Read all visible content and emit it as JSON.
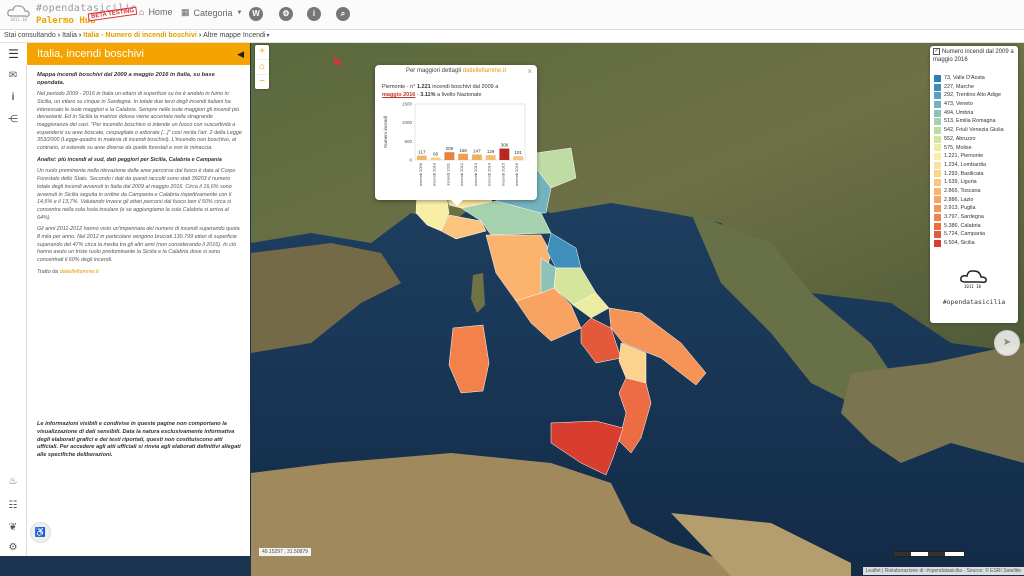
{
  "topbar": {
    "logo_line1": "#opendatasicilia",
    "logo_line2": "Palermo Hub",
    "beta_badge": "BETA TESTING",
    "home_label": "Home",
    "categoria_label": "Categoria"
  },
  "breadcrumb": {
    "prefix": "Stai consultando",
    "level1": "Italia",
    "current": "Italia - Numero di incendi boschivi",
    "next": "Altre mappe Incendi"
  },
  "panel": {
    "title": "Italia, incendi boschivi",
    "intro": "Mappa incendi boschivi dal 2009 a maggio 2016 in Italia, su base opendata.",
    "para1": "Nel periodo 2009 - 2016 in Italia un ettaro di superficie su tre è andato in fumo in Sicilia, un ettaro su cinque in Sardegna. In totale due terzi degli incendi italiani ha interessato le isole maggiori e la Calabria. Sempre nelle isole maggiori gli incendi più devastanti. Ed in Sicilia la matrice dolosa viene accertata nella stragrande maggioranza dei casi. \"Per incendio boschivo si intende un fuoco con suscettività a espandersi su aree boscate, cespugliate o arborate [...]\" così recita l'art. 2 della Legge 353/2000 (Legge-quadro in materia di incendi boschivi). L'incendio non boschivo, al contrario, si estende su aree diverse da quelle forestali e non le minaccia.",
    "analisi": "Analisi: più incendi al sud, dati peggiori per Sicilia, Calabria e Campania",
    "para2": "Un ruolo preminente nella rilevazione delle aree percorse dal fuoco è data al Corpo Forestale dello Stato. Secondo i dati da questi raccolti sono stati 39203 il numero totale degli incendi avvenuti in Italia dal 2009 al maggio 2016. Circa il 16,6% sono avvenuti in Sicilia seguita in ordine da Campania e Calabria rispettivamente con il 14,6% e il 13,7%. Valutando invece gli ettari percorsi dal fuoco ben il 50% circa si concentra nella sola Isola insulare (e se aggiungiamo la sola Calabria si arriva al 64%)",
    "para3": "Gli anni 2011-2012 hanno visto un'impennata del numero di incendi superando quota 8 mila per anno. Nel 2012 in particolare vengono bruciati 130.799 ettari di superficie superando del 47% circa la media tra gli altri anni (non considerando il 2016). In ciò hanno avuto un triste ruolo predominante la Sicilia e la Calabria dove si sono concentrati il 60% degli incendi.",
    "tratto": "Tratto da",
    "tratto_link": "datiellefiamme.it",
    "footer": "Le informazioni visibili e condivise in queste pagine non comportano la visualizzazione di dati sensibili. Data la natura esclusivamente informativa degli elaborati grafici e dei testi riportati, questi non costituiscono atti ufficiali. Per accedere agli atti ufficiali si rinvia agli elaborati definitivi allegati alle specifiche deliberazioni."
  },
  "popup": {
    "header_prefix": "Per maggiori dettagli",
    "header_link": "datiellefiamme.it",
    "region": "Piemonte",
    "count_text": "1.221",
    "desc_mid": "incendi boschivi dal 2009 a",
    "period": "maggio 2016",
    "share": "3.11%",
    "desc_end": "a livello Nazionale"
  },
  "chart_data": {
    "type": "bar",
    "title": "",
    "xlabel": "",
    "ylabel": "Numero incendi",
    "ylim": [
      0,
      1500
    ],
    "yticks": [
      0,
      500,
      1000,
      1500
    ],
    "categories": [
      "incendi 2009",
      "incendi 2010",
      "incendi 2011",
      "incendi 2012",
      "incendi 2013",
      "incendi 2014",
      "incendi 2015",
      "incendi 2016"
    ],
    "values": [
      117,
      66,
      209,
      166,
      147,
      129,
      306,
      101
    ],
    "colors": [
      "#f2b56a",
      "#f7d08a",
      "#e7833e",
      "#ee9f52",
      "#f1ad5f",
      "#f4bd72",
      "#b8281e",
      "#f5c47e"
    ]
  },
  "legend": {
    "title": "Numero incendi dal 2009 a maggio 2016",
    "items": [
      {
        "label": "73, Valle D'Aosta",
        "color": "#2c7fb8"
      },
      {
        "label": "227, Marche",
        "color": "#3f8fbd"
      },
      {
        "label": "292, Trentino Alto Adige",
        "color": "#5aa1bf"
      },
      {
        "label": "473, Veneto",
        "color": "#73b3be"
      },
      {
        "label": "494, Umbria",
        "color": "#8cc2b8"
      },
      {
        "label": "513, Emilia Romagna",
        "color": "#a6d1ae"
      },
      {
        "label": "542, Friuli Venezia Giulia",
        "color": "#bfdca5"
      },
      {
        "label": "552, Abruzzo",
        "color": "#d6e59c"
      },
      {
        "label": "575, Molise",
        "color": "#eaeca0"
      },
      {
        "label": "1.221, Piemonte",
        "color": "#f8eea5"
      },
      {
        "label": "1.234, Lombardia",
        "color": "#fbe29a"
      },
      {
        "label": "1.293, Basilicata",
        "color": "#fcd38c"
      },
      {
        "label": "1.639, Liguria",
        "color": "#fcc47d"
      },
      {
        "label": "2.865, Toscana",
        "color": "#fbb36e"
      },
      {
        "label": "2.886, Lazio",
        "color": "#f9a362"
      },
      {
        "label": "2.913, Puglia",
        "color": "#f69357"
      },
      {
        "label": "3.797, Sardegna",
        "color": "#f2814c"
      },
      {
        "label": "5.386, Calabria",
        "color": "#ec6d43"
      },
      {
        "label": "5.724, Campania",
        "color": "#e4593a"
      },
      {
        "label": "6.504, Sicilia",
        "color": "#d73e2f"
      }
    ],
    "brand": "#opendatasicilia"
  },
  "map": {
    "coords": "49.15297 ; 31.50879",
    "attribution": "Leaflet | Rielaborazione di: #opendatasicilia - Source: © ESRI Satellite"
  },
  "colors": {
    "accent": "#f5a300",
    "link": "#e29a00"
  }
}
